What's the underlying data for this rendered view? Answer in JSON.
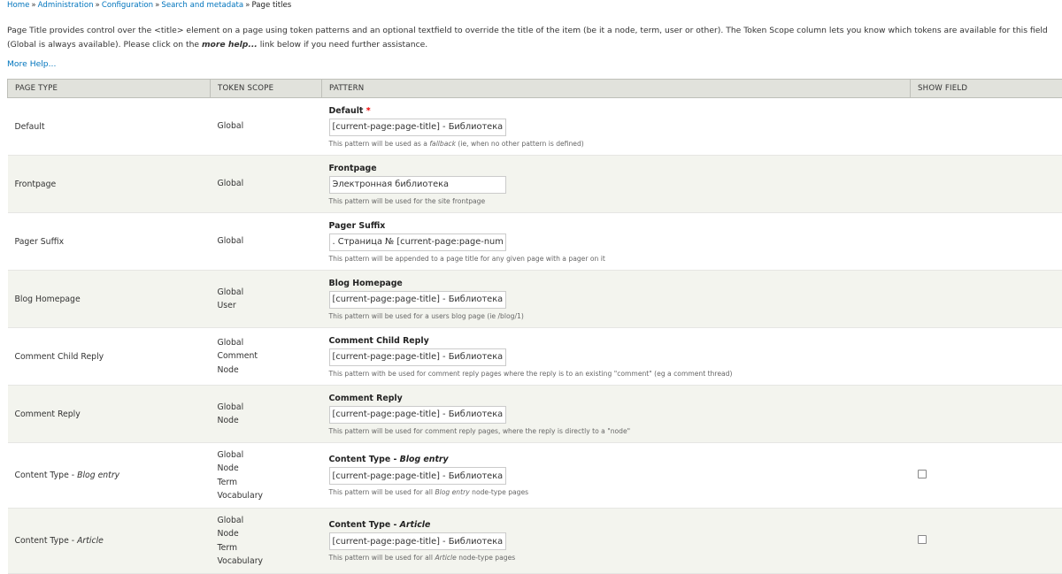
{
  "breadcrumb": {
    "items": [
      "Home",
      "Administration",
      "Configuration",
      "Search and metadata"
    ],
    "separator": "»",
    "current": "Page titles"
  },
  "intro": {
    "part1": "Page Title provides control over the <title> element on a page using token patterns and an optional textfield to override the title of the item (be it a node, term, user or other). The Token Scope column lets you know which tokens are available for this field (Global is always available). Please click on the ",
    "emphasis": "more help...",
    "part2": " link below if you need further assistance."
  },
  "more_help": "More Help...",
  "table": {
    "headers": {
      "page_type": "PAGE TYPE",
      "token_scope": "TOKEN SCOPE",
      "pattern": "PATTERN",
      "show_field": "SHOW FIELD"
    },
    "rows": [
      {
        "type": "Default",
        "type_em": "",
        "scopes": [
          "Global"
        ],
        "label": "Default",
        "label_em": "",
        "required": true,
        "value": "[current-page:page-title] - Библиотека",
        "desc_parts": [
          "This pattern will be used as a ",
          "fallback",
          " (ie, when no other pattern is defined)"
        ],
        "show_checkbox": false
      },
      {
        "type": "Frontpage",
        "type_em": "",
        "scopes": [
          "Global"
        ],
        "label": "Frontpage",
        "label_em": "",
        "required": false,
        "value": "Электронная библиотека",
        "desc_parts": [
          "This pattern will be used for the site frontpage"
        ],
        "show_checkbox": false
      },
      {
        "type": "Pager Suffix",
        "type_em": "",
        "scopes": [
          "Global"
        ],
        "label": "Pager Suffix",
        "label_em": "",
        "required": false,
        "value": ". Страница № [current-page:page-number]",
        "desc_parts": [
          "This pattern will be appended to a page title for any given page with a pager on it"
        ],
        "show_checkbox": false
      },
      {
        "type": "Blog Homepage",
        "type_em": "",
        "scopes": [
          "Global",
          "User"
        ],
        "label": "Blog Homepage",
        "label_em": "",
        "required": false,
        "value": "[current-page:page-title] - Библиотека",
        "desc_parts": [
          "This pattern will be used for a users blog page (ie /blog/1)"
        ],
        "show_checkbox": false
      },
      {
        "type": "Comment Child Reply",
        "type_em": "",
        "scopes": [
          "Global",
          "Comment",
          "Node"
        ],
        "label": "Comment Child Reply",
        "label_em": "",
        "required": false,
        "value": "[current-page:page-title] - Библиотека",
        "desc_parts": [
          "This pattern with be used for comment reply pages where the reply is to an existing \"comment\" (eg a comment thread)"
        ],
        "show_checkbox": false
      },
      {
        "type": "Comment Reply",
        "type_em": "",
        "scopes": [
          "Global",
          "Node"
        ],
        "label": "Comment Reply",
        "label_em": "",
        "required": false,
        "value": "[current-page:page-title] - Библиотека",
        "desc_parts": [
          "This pattern will be used for comment reply pages, where the reply is directly to a \"node\""
        ],
        "show_checkbox": false
      },
      {
        "type": "Content Type - ",
        "type_em": "Blog entry",
        "scopes": [
          "Global",
          "Node",
          "Term",
          "Vocabulary"
        ],
        "label": "Content Type - ",
        "label_em": "Blog entry",
        "required": false,
        "value": "[current-page:page-title] - Библиотека",
        "desc_parts": [
          "This pattern will be used for all ",
          "Blog entry",
          " node-type pages"
        ],
        "show_checkbox": true
      },
      {
        "type": "Content Type - ",
        "type_em": "Article",
        "scopes": [
          "Global",
          "Node",
          "Term",
          "Vocabulary"
        ],
        "label": "Content Type - ",
        "label_em": "Article",
        "required": false,
        "value": "[current-page:page-title] - Библиотека",
        "desc_parts": [
          "This pattern will be used for all ",
          "Article",
          " node-type pages"
        ],
        "show_checkbox": true
      }
    ]
  }
}
